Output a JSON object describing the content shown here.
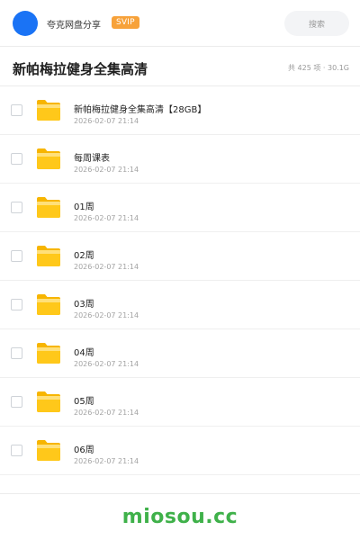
{
  "header": {
    "account_name": "夸克网盘分享",
    "badge": "SVIP",
    "search_label": "搜索",
    "colors": {
      "avatar": "#1a73f5",
      "badge": "#f7a23a"
    }
  },
  "folder": {
    "title": "新帕梅拉健身全集高清",
    "meta": "共 425 项 · 30.1G"
  },
  "files": [
    {
      "name": "新帕梅拉健身全集高清【28GB】",
      "date": "2026-02-07 21:14",
      "icon": "folder-icon"
    },
    {
      "name": "每周课表",
      "date": "2026-02-07 21:14",
      "icon": "folder-icon"
    },
    {
      "name": "01周",
      "date": "2026-02-07 21:14",
      "icon": "folder-icon"
    },
    {
      "name": "02周",
      "date": "2026-02-07 21:14",
      "icon": "folder-icon"
    },
    {
      "name": "03周",
      "date": "2026-02-07 21:14",
      "icon": "folder-icon"
    },
    {
      "name": "04周",
      "date": "2026-02-07 21:14",
      "icon": "folder-icon"
    },
    {
      "name": "05周",
      "date": "2026-02-07 21:14",
      "icon": "folder-icon"
    },
    {
      "name": "06周",
      "date": "2026-02-07 21:14",
      "icon": "folder-icon"
    }
  ],
  "footer": {
    "watermark": "miosou.cc",
    "watermark_color": "#3fb14a"
  }
}
